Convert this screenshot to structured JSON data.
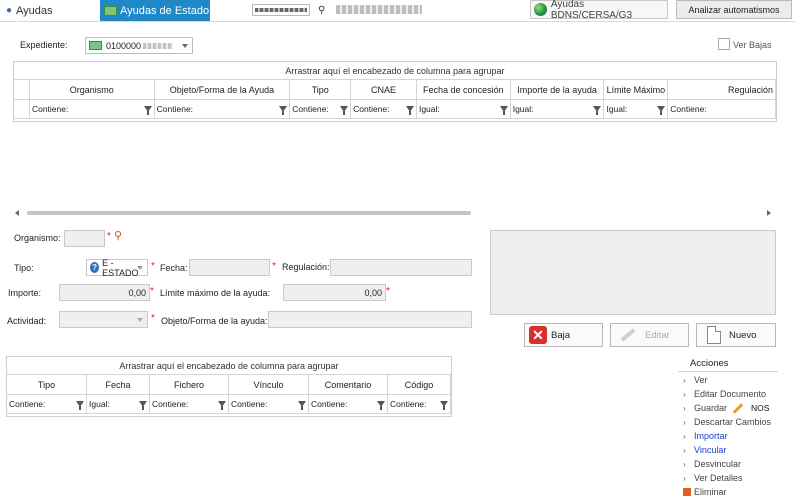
{
  "topbar": {
    "ayudas_tab": "Ayudas",
    "estado_tab": "Ayudas de Estado",
    "code_value": "",
    "name_value": "",
    "bdns_button": "Ayudas BDNS/CERSA/G3",
    "analizar_button": "Analizar automatismos"
  },
  "expediente": {
    "label": "Expediente:",
    "value": "0100000",
    "ver_bajas": "Ver Bajas"
  },
  "grid1": {
    "group_hint": "Arrastrar aquí el encabezado de columna para agrupar",
    "columns": [
      "Organismo",
      "Objeto/Forma de la Ayuda",
      "Tipo",
      "CNAE",
      "Fecha de concesión",
      "Importe de la ayuda",
      "Límite Máximo",
      "Regulación"
    ],
    "filters": [
      "Contiene:",
      "Contiene:",
      "Contiene:",
      "Contiene:",
      "Igual:",
      "Igual:",
      "Igual:",
      "Contiene:"
    ]
  },
  "form": {
    "organismo_label": "Organismo:",
    "organismo_value": "",
    "tipo_label": "Tipo:",
    "tipo_value": "E - ESTADO",
    "fecha_label": "Fecha:",
    "fecha_value": "",
    "regulacion_label": "Regulación:",
    "regulacion_value": "",
    "importe_label": "Importe:",
    "importe_value": "0,00",
    "limite_label": "Límite máximo de la ayuda:",
    "limite_value": "0,00",
    "actividad_label": "Actividad:",
    "actividad_value": "",
    "objeto_label": "Objeto/Forma de la ayuda:",
    "objeto_value": ""
  },
  "buttons": {
    "baja": "Baja",
    "editar": "Editar",
    "nuevo": "Nuevo"
  },
  "grid2": {
    "group_hint": "Arrastrar aquí el encabezado de columna para agrupar",
    "columns": [
      "Tipo",
      "Fecha",
      "Fichero",
      "Vínculo",
      "Comentario",
      "Código"
    ],
    "filters": [
      "Contiene:",
      "Igual:",
      "Contiene:",
      "Contiene:",
      "Contiene:",
      "Contiene:"
    ]
  },
  "acciones": {
    "title": "Acciones",
    "items": [
      "Ver",
      "Editar Documento",
      "Guardar",
      "Descartar Cambios",
      "Importar",
      "Vincular",
      "Desvincular",
      "Ver Detalles",
      "Eliminar"
    ],
    "guardar_note": "NOS"
  },
  "colors": {
    "accent_tab": "#1f88c7",
    "required": "#d22222",
    "link": "#1a3ec8",
    "baja_icon": "#d9302b"
  }
}
